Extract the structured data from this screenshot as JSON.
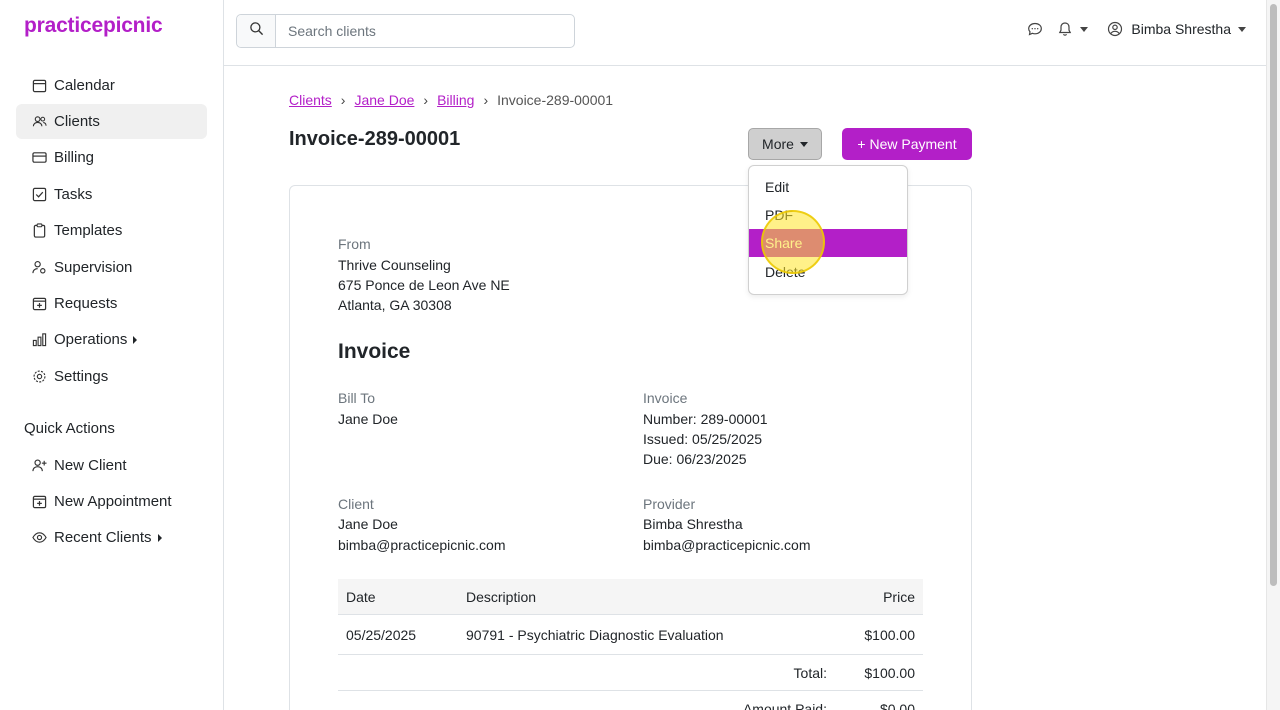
{
  "app": {
    "logo": "practicepicnic"
  },
  "sidebar": {
    "items": [
      {
        "label": "Calendar",
        "icon": "calendar-icon"
      },
      {
        "label": "Clients",
        "icon": "users-icon",
        "active": true
      },
      {
        "label": "Billing",
        "icon": "credit-card-icon"
      },
      {
        "label": "Tasks",
        "icon": "checkbox-icon"
      },
      {
        "label": "Templates",
        "icon": "clipboard-icon"
      },
      {
        "label": "Supervision",
        "icon": "person-gear-icon"
      },
      {
        "label": "Requests",
        "icon": "calendar-plus-icon"
      },
      {
        "label": "Operations",
        "icon": "bar-chart-icon",
        "expandable": true
      },
      {
        "label": "Settings",
        "icon": "gear-icon"
      }
    ],
    "quick_actions_title": "Quick Actions",
    "quick_actions": [
      {
        "label": "New Client",
        "icon": "person-add-icon"
      },
      {
        "label": "New Appointment",
        "icon": "calendar-plus-icon"
      },
      {
        "label": "Recent Clients",
        "icon": "eye-icon",
        "expandable": true
      }
    ]
  },
  "topbar": {
    "search_placeholder": "Search clients",
    "user_name": "Bimba Shrestha"
  },
  "breadcrumb": {
    "clients": "Clients",
    "client": "Jane Doe",
    "billing": "Billing",
    "current": "Invoice-289-00001",
    "separator": "›"
  },
  "page": {
    "title": "Invoice-289-00001",
    "more_label": "More",
    "new_payment_label": "+ New Payment"
  },
  "dropdown": {
    "items": [
      "Edit",
      "PDF",
      "Share",
      "Delete"
    ],
    "active_index": 2
  },
  "invoice": {
    "from_label": "From",
    "from_name": "Thrive Counseling",
    "from_address1": "675 Ponce de Leon Ave NE",
    "from_address2": "Atlanta, GA 30308",
    "heading": "Invoice",
    "bill_to_label": "Bill To",
    "bill_to_name": "Jane Doe",
    "invoice_label": "Invoice",
    "number": "Number: 289-00001",
    "issued": "Issued: 05/25/2025",
    "due": "Due: 06/23/2025",
    "client_label": "Client",
    "client_name": "Jane Doe",
    "client_email": "bimba@practicepicnic.com",
    "provider_label": "Provider",
    "provider_name": "Bimba Shrestha",
    "provider_email": "bimba@practicepicnic.com"
  },
  "table": {
    "headers": {
      "date": "Date",
      "description": "Description",
      "price": "Price"
    },
    "rows": [
      {
        "date": "05/25/2025",
        "description": "90791 - Psychiatric Diagnostic Evaluation",
        "price": "$100.00"
      }
    ],
    "total_label": "Total:",
    "total_value": "$100.00",
    "amount_paid_label": "Amount Paid:",
    "amount_paid_value": "$0.00"
  },
  "colors": {
    "brand": "#b31fc8"
  }
}
